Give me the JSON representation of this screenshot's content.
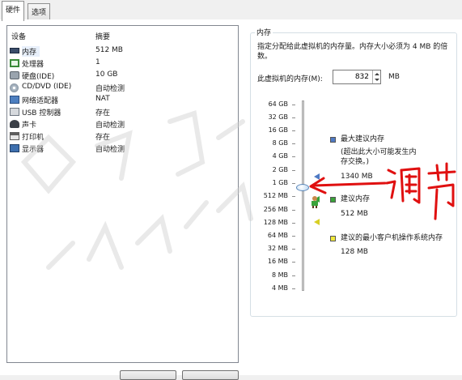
{
  "tabs": [
    {
      "label": "硬件",
      "active": true
    },
    {
      "label": "选项",
      "active": false
    }
  ],
  "device_list": {
    "header": {
      "device": "设备",
      "summary": "摘要"
    },
    "rows": [
      {
        "name": "内存",
        "summary": "512 MB",
        "icon": "memory-icon",
        "selected": true
      },
      {
        "name": "处理器",
        "summary": "1",
        "icon": "processor-icon"
      },
      {
        "name": "硬盘(IDE)",
        "summary": "10 GB",
        "icon": "hard-disk-icon"
      },
      {
        "name": "CD/DVD (IDE)",
        "summary": "自动检测",
        "icon": "cd-dvd-icon"
      },
      {
        "name": "网络适配器",
        "summary": "NAT",
        "icon": "network-adapter-icon"
      },
      {
        "name": "USB 控制器",
        "summary": "存在",
        "icon": "usb-controller-icon"
      },
      {
        "name": "声卡",
        "summary": "自动检测",
        "icon": "sound-card-icon"
      },
      {
        "name": "打印机",
        "summary": "存在",
        "icon": "printer-icon"
      },
      {
        "name": "显示器",
        "summary": "自动检测",
        "icon": "display-icon"
      }
    ]
  },
  "memory": {
    "title": "内存",
    "description": "指定分配给此虚拟机的内存量。内存大小必须为 4 MB 的倍数。",
    "field_label": "此虚拟机的内存(M):",
    "value": "832",
    "unit": "MB",
    "scale_labels": [
      "64 GB",
      "32 GB",
      "16 GB",
      "8 GB",
      "4 GB",
      "2 GB",
      "1 GB",
      "512 MB",
      "256 MB",
      "128 MB",
      "64 MB",
      "32 MB",
      "16 MB",
      "8 MB",
      "4 MB"
    ],
    "legend": {
      "max_recommended_label": "最大建议内存",
      "max_recommended_note": "(超出此大小可能发生内存交换。)",
      "max_recommended_value": "1340 MB",
      "recommended_label": "建议内存",
      "recommended_value": "512 MB",
      "min_guest_label": "建议的最小客户机操作系统内存",
      "min_guest_value": "128 MB"
    },
    "colors": {
      "max_recommended": "#4f7ac4",
      "recommended": "#3aa33a",
      "min_guest": "#d8cf24"
    }
  },
  "annotation": {
    "text": "调节",
    "color": "#e01010"
  },
  "watermark": {
    "text": "yinmajiance.com"
  }
}
